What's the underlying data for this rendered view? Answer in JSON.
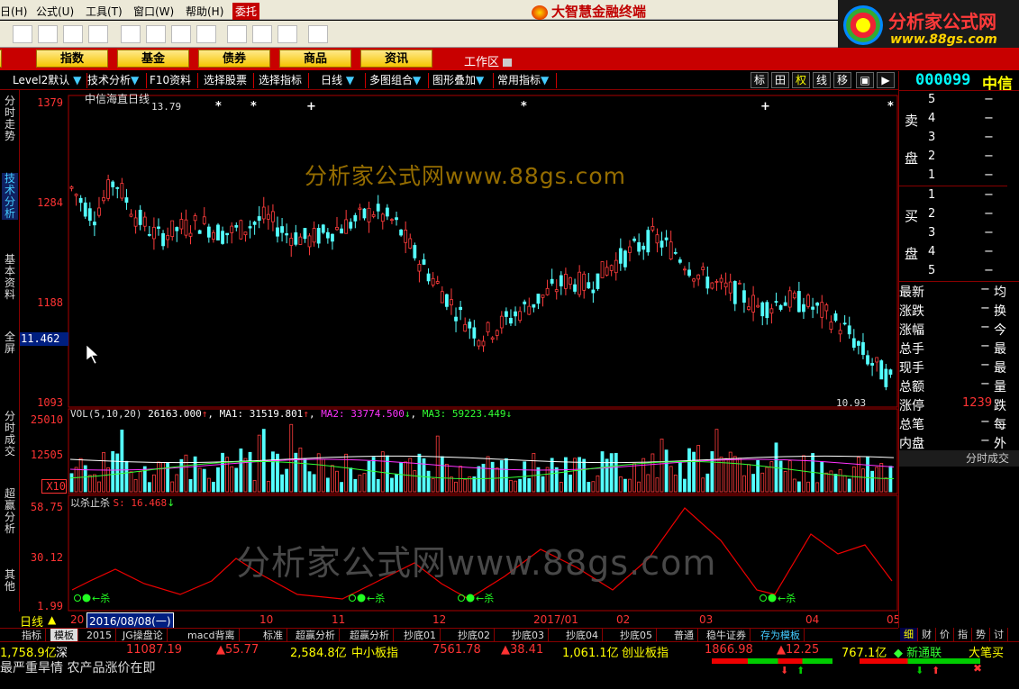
{
  "menu": [
    "日(H)",
    "公式(U)",
    "工具(T)",
    "窗口(W)",
    "帮助(H)",
    "委托"
  ],
  "app_title": "大智慧金融终端",
  "brand": {
    "name": "分析家公式网",
    "url": "www.88gs.com"
  },
  "toolbar_icons": [
    "binoculars-icon",
    "columns-icon",
    "chart-icon",
    "arrow-icon",
    "diamond-icon",
    "window-icon",
    "help-icon"
  ],
  "nav": [
    "",
    "指数",
    "基金",
    "债券",
    "商品",
    "资讯"
  ],
  "workarea": "工作区",
  "chartbar": {
    "items": [
      "Level2默认",
      "技术分析",
      "F10资料",
      "选择股票",
      "选择指标",
      "日线",
      "多图组合",
      "图形叠加",
      "常用指标"
    ],
    "right": [
      "标",
      "田",
      "权",
      "线",
      "移",
      "▣",
      "▶"
    ]
  },
  "leftnav": [
    "分时走势",
    "技术分析",
    "基本资料",
    "全屏",
    "分时成交",
    "超赢分析",
    "其他"
  ],
  "price_panel": {
    "title": "中信海直日线",
    "y_ticks": [
      "1379",
      "1284",
      "1188",
      "1093"
    ],
    "cursor_value": "11.462",
    "high_label": "13.79",
    "low_label": "10.93"
  },
  "watermark": "分析家公式网www.88gs.com",
  "vol_panel": {
    "label": "VOL(5,10,20)",
    "value": "26163.000",
    "ma1": "MA1: 31519.801",
    "ma2": "MA2: 33774.500",
    "ma3": "MA3: 59223.449",
    "y_ticks": [
      "25010",
      "12505",
      "X10"
    ]
  },
  "ind_panel": {
    "label": "以杀止杀",
    "s_value": "S: 16.468",
    "y_ticks": [
      "58.75",
      "30.12",
      "1.99"
    ],
    "signal_label": "←杀"
  },
  "date_axis": {
    "period": "日线",
    "current": "2016/08/08(一)",
    "labels": [
      "20",
      "10",
      "11",
      "12",
      "2017/01",
      "02",
      "03",
      "04",
      "05"
    ]
  },
  "tabs": [
    "指标",
    "模板",
    "2015",
    "JG操盘论",
    "macd背离",
    "标准",
    "超赢分析",
    "超赢分析",
    "抄底01",
    "抄底02",
    "抄底03",
    "抄底04",
    "抄底05",
    "普通",
    "稳牛证券",
    "存为模板"
  ],
  "right_tabs": [
    "细",
    "财",
    "价",
    "指",
    "势",
    "讨"
  ],
  "ticker": [
    "1,758.9亿",
    "深",
    "11087.19",
    "▲55.77",
    "2,584.8亿",
    "中小板指",
    "7561.78",
    "▲38.41",
    "1,061.1亿",
    "创业板指",
    "1866.98",
    "▲12.25",
    "767.1亿",
    "◆ 新通联",
    "大笔买"
  ],
  "news": "最严重旱情 农产品涨价在即",
  "quote": {
    "code": "000099",
    "name": "中信",
    "sell_label": [
      "卖",
      "盘"
    ],
    "buy_label": [
      "买",
      "盘"
    ],
    "levels": [
      "5",
      "4",
      "3",
      "2",
      "1",
      "1",
      "2",
      "3",
      "4",
      "5"
    ],
    "fields": [
      [
        "最新",
        "均"
      ],
      [
        "涨跌",
        "换"
      ],
      [
        "涨幅",
        "今"
      ],
      [
        "总手",
        "最"
      ],
      [
        "现手",
        "最"
      ],
      [
        "总额",
        "量"
      ],
      [
        "涨停",
        "跌"
      ],
      [
        "总笔",
        "每"
      ],
      [
        "内盘",
        "外"
      ]
    ],
    "limit_up": "1239",
    "section": "分时成交"
  }
}
